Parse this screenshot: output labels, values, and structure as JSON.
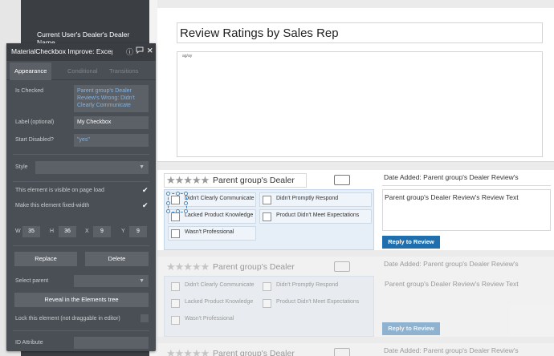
{
  "editor": {
    "tree_label": "Current User's Dealer's Dealer Name"
  },
  "panel": {
    "title": "MaterialCheckbox Improve: Excep",
    "icons": [
      "info-icon",
      "comment-icon",
      "close-icon"
    ],
    "tabs": [
      "Appearance",
      "Conditional",
      "Transitions"
    ],
    "is_checked_label": "Is Checked",
    "is_checked_value": "Parent group's Dealer Review's Wrong: Didn't Clearly Communicate",
    "label_label": "Label (optional)",
    "label_value": "My Checkbox",
    "start_disabled_label": "Start Disabled?",
    "start_disabled_value": "\"yes\"",
    "style_label": "Style",
    "style_value": "",
    "visible_label": "This element is visible on page load",
    "fixed_width_label": "Make this element fixed-width",
    "dims": {
      "w_label": "W",
      "w": "35",
      "h_label": "H",
      "h": "36",
      "x_label": "X",
      "x": "9",
      "y_label": "Y",
      "y": "9"
    },
    "replace_label": "Replace",
    "delete_label": "Delete",
    "select_parent_label": "Select parent",
    "reveal_label": "Reveal in the Elements tree",
    "lock_label": "Lock this element (not draggable in editor)",
    "id_attr_label": "ID Attribute"
  },
  "canvas": {
    "page_title": "Review Ratings by Sales Rep",
    "chart_placeholder": "ag/ay"
  },
  "review": {
    "stars": "★★★★★",
    "dealer_label": "Parent group's Dealer",
    "checkboxes": [
      "Didn't Clearly Communicate",
      "Didn't Promptly Respond",
      "Lacked Product Knowledge",
      "Product Didn't Meet Expectations",
      "Wasn't Professional"
    ],
    "date_added": "Date Added: Parent group's Dealer Review's",
    "review_text": "Parent group's Dealer Review's Review Text",
    "reply_label": "Reply to Review"
  }
}
